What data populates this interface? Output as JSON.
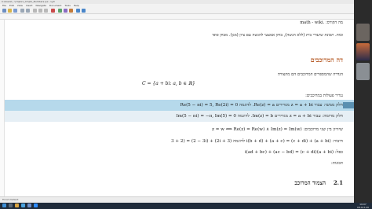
{
  "window": {
    "title": "C:\\Users\\…\\rmplx1_Cmplx_Numbers.lyx  - LyX",
    "menus": [
      "File",
      "Edit",
      "View",
      "Insert",
      "Navigate",
      "Document",
      "Tools",
      "Help"
    ],
    "status": "Finish Default"
  },
  "doc": {
    "top_line": "מה הקורס: .math - wiki",
    "intro": "ובות. תכונת שיעורי בית (ללא הגשה), בוחן אמצעי להגשה עם ציון (מגן). מבחן סופי",
    "section_title": "דה המרוכבים",
    "def_line": "הגדרה שהמספרים המרוכבים הם מהצורה",
    "set_formula": "C = {a + bi: a, b ∈ ℝ}",
    "ops_label": "נגדיר פעולות במרוכבים:",
    "row1": "חלק ממשי: עבור z = a + bi מגדירים Re(z) = a. לדוגמה Re(5 − πi) = 5, Re(2i) = 0",
    "row2": "חלק מדומה: עבור z = a + bi מגדירים Im(z) = b. לדוגמה Im(5 − πi) = −π, Im(5) = 0",
    "row3": "שיוויון בין שני מרוכבים: z = w ⟺ Re(z) = Re(w) ∧ Im(z) = Im(w)",
    "row4": "חיבור: (a + bi) + (c + di) = (a + c) + (b + d)i לדוגמה (3 + 2i) + (2 − 3i) = (3 + 2",
    "row5": "כפל: (a + bi)(c + di) = (ac − bd) + (ad + bc)i",
    "props_label": "תכונות:",
    "subsection_num": "2.1",
    "subsection_title": "הצמוד המרוכב"
  },
  "taskbar": {
    "time": "19:07",
    "date": "08-Oct-20"
  },
  "colors": {
    "highlight": "#b6d9eb",
    "title_orange": "#b3541e",
    "taskbar": "#1f2b3a"
  }
}
